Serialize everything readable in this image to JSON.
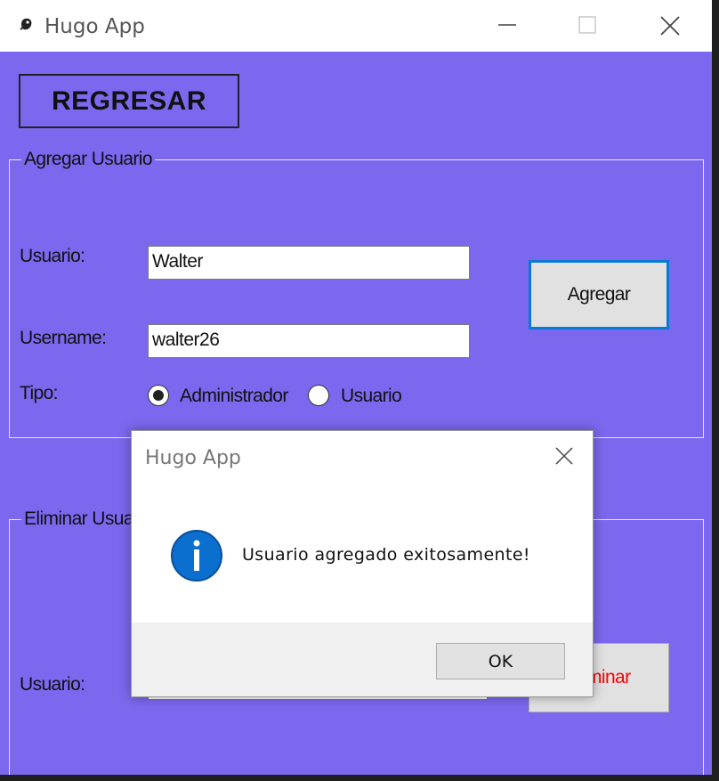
{
  "window": {
    "title": "Hugo App",
    "accent": "#7b68ee"
  },
  "toolbar": {
    "back_label": "REGRESAR"
  },
  "add_user": {
    "legend": "Agregar Usuario",
    "usuario_label": "Usuario:",
    "usuario_value": "Walter",
    "username_label": "Username:",
    "username_value": "walter26",
    "tipo_label": "Tipo:",
    "radio_admin_label": "Administrador",
    "radio_admin_selected": true,
    "radio_user_label": "Usuario",
    "add_button_label": "Agregar"
  },
  "delete_user": {
    "legend": "Eliminar Usuario",
    "usuario_label": "Usuario:",
    "delete_button_label": "Eliminar",
    "delete_button_color": "#ff0000"
  },
  "dialog": {
    "title": "Hugo App",
    "icon": "info-icon",
    "message": "Usuario agregado exitosamente!",
    "ok_label": "OK"
  }
}
